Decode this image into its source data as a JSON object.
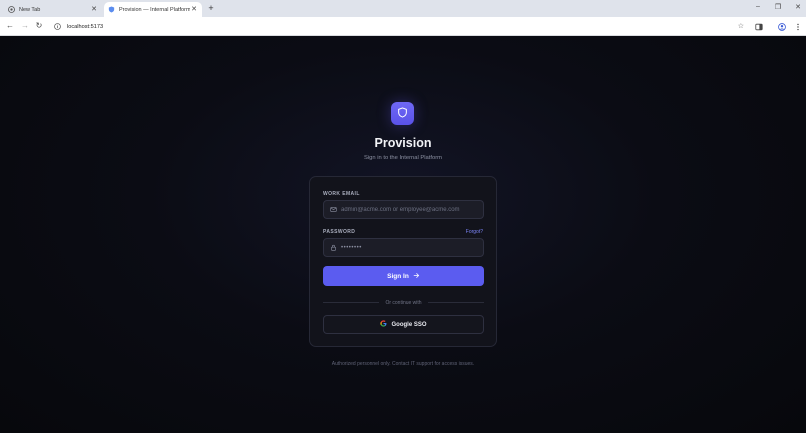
{
  "browser": {
    "tabs": [
      {
        "title": "New Tab",
        "active": false
      },
      {
        "title": "Provision — Internal Platform",
        "active": true
      }
    ],
    "url": "localhost:5173"
  },
  "app": {
    "name": "Provision",
    "subtitle": "Sign in to the Internal Platform",
    "accent": "#5b5cf0"
  },
  "form": {
    "email_label": "WORK EMAIL",
    "email_placeholder": "admin@acme.com or employee@acme.com",
    "password_label": "PASSWORD",
    "forgot_label": "Forgot?",
    "password_value": "••••••••",
    "signin_label": "Sign In",
    "divider_text": "Or continue with",
    "sso_label": "Google SSO"
  },
  "footer": "Authorized personnel only. Contact IT support for access issues.",
  "icons": {
    "logo": "shield-icon",
    "email": "mail-icon",
    "password": "lock-icon",
    "signin": "arrow-right-icon",
    "sso": "google-icon"
  }
}
